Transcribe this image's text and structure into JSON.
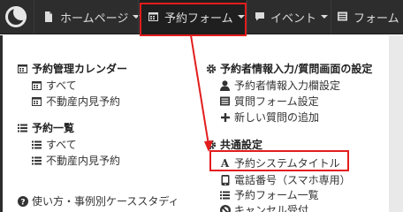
{
  "navbar": {
    "items": [
      {
        "label": "ホームページ",
        "icon": "file-icon"
      },
      {
        "label": "予約フォーム",
        "icon": "calendar-icon"
      },
      {
        "label": "イベント",
        "icon": "comment-icon"
      },
      {
        "label": "フォーム",
        "icon": "list-icon"
      }
    ]
  },
  "menu": {
    "calendar_section": {
      "title": "予約管理カレンダー",
      "items": [
        "すべて",
        "不動産内見予約"
      ]
    },
    "list_section": {
      "title": "予約一覧",
      "items": [
        "すべて",
        "不動産内見予約"
      ]
    },
    "help_link": "使い方・事例別ケーススタディ",
    "booker_section": {
      "title": "予約者情報入力/質問画面の設定",
      "items": [
        "予約者情報入力欄設定",
        "質問フォーム設定",
        "新しい質問の追加"
      ]
    },
    "common_section": {
      "title": "共通設定",
      "items": [
        "予約システムタイトル",
        "電話番号（スマホ専用）",
        "予約フォーム一覧",
        "キャンセル受付"
      ]
    }
  },
  "colors": {
    "navbar": "#2d2d2d",
    "highlight": "#e21d1d"
  }
}
